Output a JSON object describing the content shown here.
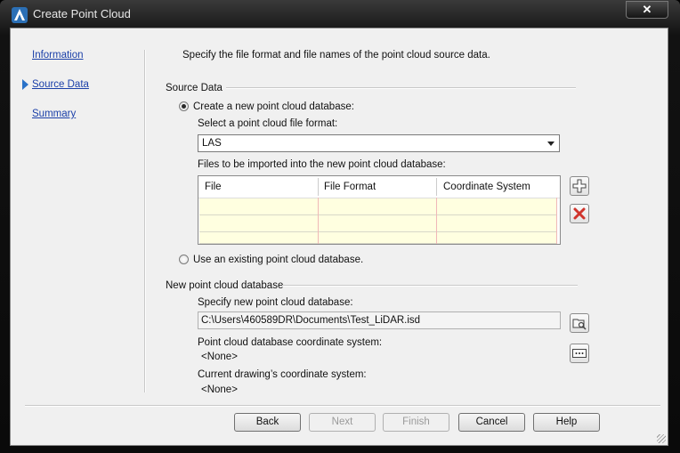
{
  "window": {
    "title": "Create Point Cloud",
    "close_label": "✕"
  },
  "nav": {
    "items": [
      {
        "label": "Information"
      },
      {
        "label": "Source Data"
      },
      {
        "label": "Summary"
      }
    ],
    "active": "Source Data"
  },
  "main": {
    "instructions": "Specify the file format and file names of the point cloud source data.",
    "source_group": "Source Data",
    "radio_new_label": "Create a new point cloud database:",
    "format_label": "Select a point cloud file format:",
    "format_value": "LAS",
    "files_label": "Files to be imported into the new point cloud database:",
    "columns": [
      "File",
      "File Format",
      "Coordinate System"
    ],
    "rows": [
      [
        "",
        "",
        ""
      ],
      [
        "",
        "",
        ""
      ],
      [
        "",
        "",
        ""
      ]
    ],
    "radio_existing_label": "Use an existing point cloud database.",
    "db_group": "New point cloud database",
    "db_path_label": "Specify new point cloud database:",
    "db_path_value": "C:\\Users\\460589DR\\Documents\\Test_LiDAR.isd",
    "db_cs_label": "Point cloud database coordinate system:",
    "db_cs_value": "<None>",
    "drawing_cs_label": "Current drawing’s coordinate system:",
    "drawing_cs_value": "<None>"
  },
  "footer": {
    "back": "Back",
    "next": "Next",
    "finish": "Finish",
    "cancel": "Cancel",
    "help": "Help"
  },
  "colors": {
    "link": "#1a3fa8",
    "row_fill": "#ffffe0",
    "active_arrow": "#2a72c8",
    "remove_icon": "#d0342c"
  }
}
